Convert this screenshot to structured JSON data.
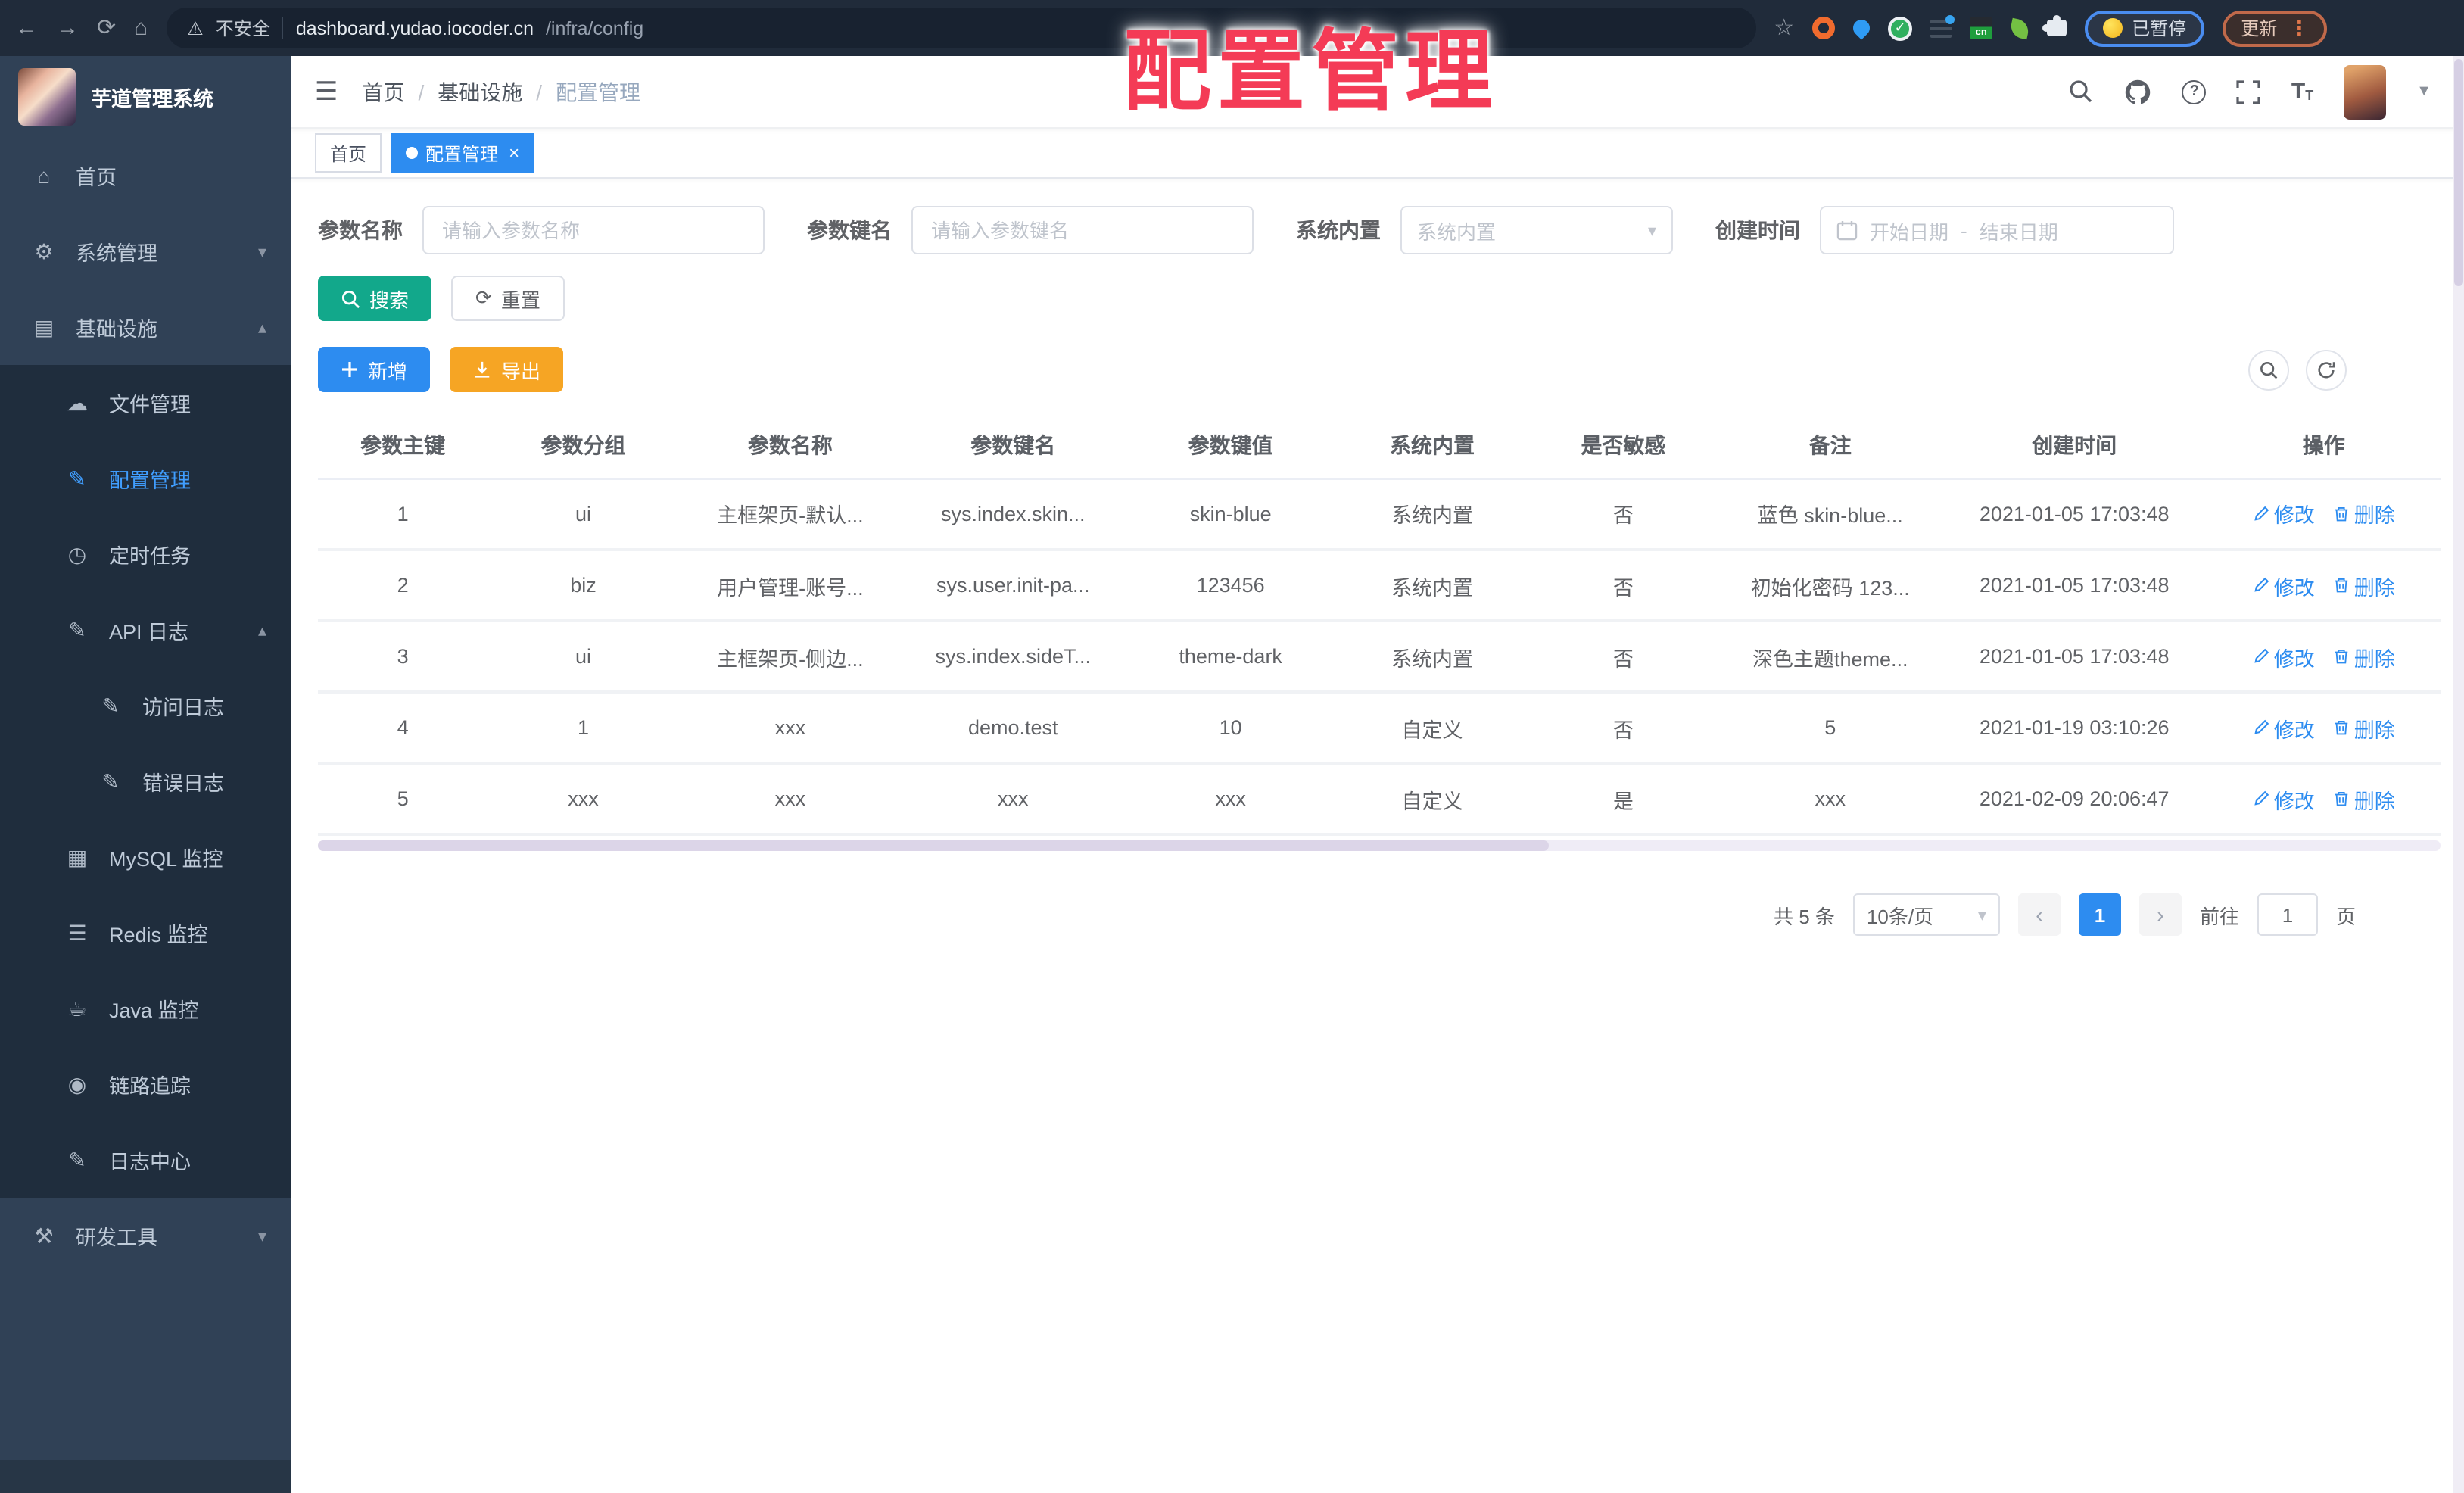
{
  "icons": {
    "back": "←",
    "forward": "→",
    "reload": "⟳",
    "home": "⌂",
    "warning": "⚠",
    "star": "☆",
    "check": "✓",
    "cn_label": "cn",
    "kebab": "⋮",
    "hamburger": "☰",
    "caret_down": "▾",
    "caret_up": "▴",
    "select_caret": "▾",
    "avatar_caret": "▼",
    "prev": "‹",
    "next": "›",
    "close": "×",
    "question": "?",
    "font_big": "T",
    "font_small": "T",
    "reset": "⟳"
  },
  "browser": {
    "security_text": "不安全",
    "url_host": "dashboard.yudao.iocoder.cn",
    "url_path": "/infra/config",
    "paused_label": "已暂停",
    "update_label": "更新"
  },
  "overlay_title": "配置管理",
  "sidebar": {
    "app_title": "芋道管理系统",
    "items": [
      {
        "id": "home",
        "label": "首页",
        "icon": "home-icon",
        "glyph": "⌂",
        "level": 0
      },
      {
        "id": "system",
        "label": "系统管理",
        "icon": "gear-icon",
        "glyph": "⚙",
        "level": 0,
        "chevron": "down"
      },
      {
        "id": "infra",
        "label": "基础设施",
        "icon": "monitor-chart-icon",
        "glyph": "▤",
        "level": 0,
        "chevron": "up"
      },
      {
        "id": "file",
        "label": "文件管理",
        "icon": "cloud-icon",
        "glyph": "☁",
        "level": 1
      },
      {
        "id": "config",
        "label": "配置管理",
        "icon": "edit-icon",
        "glyph": "✎",
        "level": 1,
        "active": true
      },
      {
        "id": "job",
        "label": "定时任务",
        "icon": "timer-icon",
        "glyph": "◷",
        "level": 1
      },
      {
        "id": "api-log",
        "label": "API 日志",
        "icon": "log-icon",
        "glyph": "✎",
        "level": 1,
        "chevron": "up"
      },
      {
        "id": "access-log",
        "label": "访问日志",
        "icon": "log-icon",
        "glyph": "✎",
        "level": 2
      },
      {
        "id": "error-log",
        "label": "错误日志",
        "icon": "log-icon",
        "glyph": "✎",
        "level": 2
      },
      {
        "id": "mysql",
        "label": "MySQL 监控",
        "icon": "mysql-monitor-icon",
        "glyph": "▦",
        "level": 1
      },
      {
        "id": "redis",
        "label": "Redis 监控",
        "icon": "redis-layers-icon",
        "glyph": "☰",
        "level": 1
      },
      {
        "id": "java",
        "label": "Java 监控",
        "icon": "java-cup-icon",
        "glyph": "☕",
        "level": 1
      },
      {
        "id": "trace",
        "label": "链路追踪",
        "icon": "eye-icon",
        "glyph": "◉",
        "level": 1
      },
      {
        "id": "log-center",
        "label": "日志中心",
        "icon": "log-icon",
        "glyph": "✎",
        "level": 1
      },
      {
        "id": "dev-tools",
        "label": "研发工具",
        "icon": "tools-icon",
        "glyph": "⚒",
        "level": 0,
        "chevron": "down"
      }
    ]
  },
  "header": {
    "breadcrumb": [
      "首页",
      "基础设施",
      "配置管理"
    ],
    "breadcrumb_separator": "/"
  },
  "tabs": [
    {
      "label": "首页",
      "active": false
    },
    {
      "label": "配置管理",
      "active": true
    }
  ],
  "filters": {
    "name_label": "参数名称",
    "name_placeholder": "请输入参数名称",
    "key_label": "参数键名",
    "key_placeholder": "请输入参数键名",
    "type_label": "系统内置",
    "type_placeholder": "系统内置",
    "date_label": "创建时间",
    "date_start_placeholder": "开始日期",
    "date_separator": "-",
    "date_end_placeholder": "结束日期",
    "search_label": "搜索",
    "reset_label": "重置"
  },
  "toolbar": {
    "add_label": "新增",
    "export_label": "导出"
  },
  "table": {
    "columns": [
      "参数主键",
      "参数分组",
      "参数名称",
      "参数键名",
      "参数键值",
      "系统内置",
      "是否敏感",
      "备注",
      "创建时间",
      "操作"
    ],
    "rows": [
      [
        "1",
        "ui",
        "主框架页-默认...",
        "sys.index.skin...",
        "skin-blue",
        "系统内置",
        "否",
        "蓝色 skin-blue...",
        "2021-01-05 17:03:48"
      ],
      [
        "2",
        "biz",
        "用户管理-账号...",
        "sys.user.init-pa...",
        "123456",
        "系统内置",
        "否",
        "初始化密码 123...",
        "2021-01-05 17:03:48"
      ],
      [
        "3",
        "ui",
        "主框架页-侧边...",
        "sys.index.sideT...",
        "theme-dark",
        "系统内置",
        "否",
        "深色主题theme...",
        "2021-01-05 17:03:48"
      ],
      [
        "4",
        "1",
        "xxx",
        "demo.test",
        "10",
        "自定义",
        "否",
        "5",
        "2021-01-19 03:10:26"
      ],
      [
        "5",
        "xxx",
        "xxx",
        "xxx",
        "xxx",
        "自定义",
        "是",
        "xxx",
        "2021-02-09 20:06:47"
      ]
    ],
    "modify_label": "修改",
    "delete_label": "删除"
  },
  "pagination": {
    "total_text": "共 5 条",
    "page_size": "10条/页",
    "current_page": "1",
    "goto_label": "前往",
    "goto_value": "1",
    "page_unit": "页"
  }
}
